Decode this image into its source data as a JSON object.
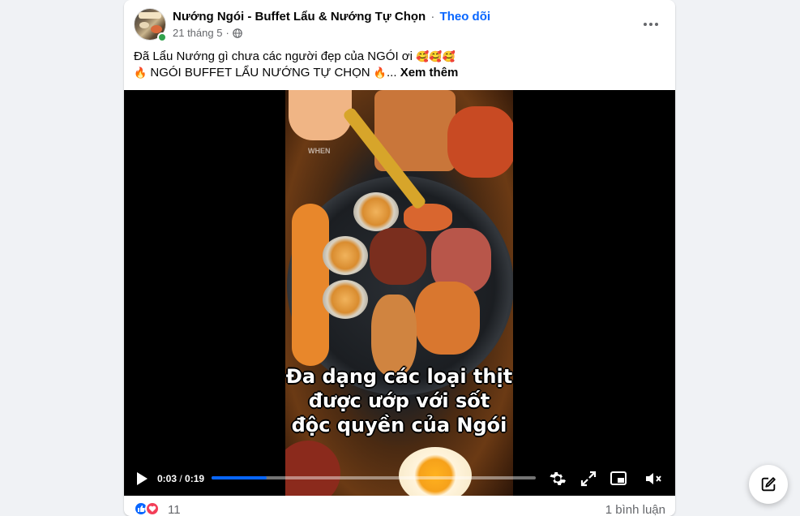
{
  "post": {
    "page_name": "Nướng Ngói - Buffet Lẩu & Nướng Tự Chọn",
    "separator": "·",
    "follow_label": "Theo dõi",
    "date": "21 tháng 5",
    "date_separator": "·",
    "audience_icon": "globe-icon",
    "more_icon": "more-horizontal-icon",
    "caption_line1_text": "Đã Lẩu Nướng gì chưa các người đẹp của NGÓI ơi",
    "caption_line1_emoji": "🥰🥰🥰",
    "caption_line2_emoji_start": "🔥",
    "caption_line2_text": "NGÓI BUFFET LẨU NƯỚNG TỰ CHỌN",
    "caption_line2_emoji_end": "🔥",
    "caption_ellipsis": "...",
    "see_more_label": "Xem thêm"
  },
  "video": {
    "watermark": "WHEN",
    "overlay_lines": [
      "Đa dạng các loại thịt",
      "được ướp với sốt",
      "độc quyền của Ngói"
    ],
    "current_time": "0:03",
    "time_separator": " / ",
    "duration": "0:19",
    "progress": 0.17,
    "accent_color": "#0866ff"
  },
  "footer": {
    "reaction_count": "11",
    "comment_count_label": "1 bình luận"
  },
  "compose": {
    "icon": "compose-icon"
  }
}
